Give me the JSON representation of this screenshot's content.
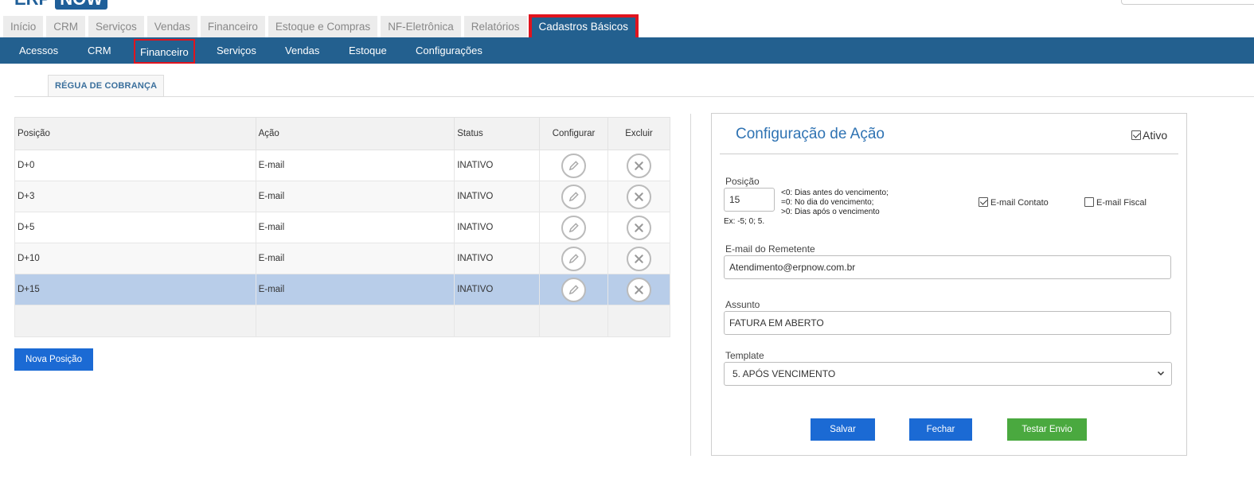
{
  "app": {
    "logo_prefix": "ERP",
    "logo_suffix": "NOW"
  },
  "main_tabs": [
    "Início",
    "CRM",
    "Serviços",
    "Vendas",
    "Financeiro",
    "Estoque e Compras",
    "NF-Eletrônica",
    "Relatórios",
    "Cadastros Básicos"
  ],
  "sub_nav": [
    "Acessos",
    "CRM",
    "Financeiro",
    "Serviços",
    "Vendas",
    "Estoque",
    "Configurações"
  ],
  "page_tab": "RÉGUA DE COBRANÇA",
  "table": {
    "headers": [
      "Posição",
      "Ação",
      "Status",
      "Configurar",
      "Excluir"
    ],
    "rows": [
      {
        "posicao": "D+0",
        "acao": "E-mail",
        "status": "INATIVO"
      },
      {
        "posicao": "D+3",
        "acao": "E-mail",
        "status": "INATIVO"
      },
      {
        "posicao": "D+5",
        "acao": "E-mail",
        "status": "INATIVO"
      },
      {
        "posicao": "D+10",
        "acao": "E-mail",
        "status": "INATIVO"
      },
      {
        "posicao": "D+15",
        "acao": "E-mail",
        "status": "INATIVO"
      }
    ]
  },
  "nova_posicao_label": "Nova Posição",
  "panel": {
    "title": "Configuração de Ação",
    "ativo_label": "Ativo",
    "posicao_label": "Posição",
    "posicao_value": "15",
    "hint_lines": [
      "<0: Dias antes do vencimento;",
      "=0: No dia do vencimento;",
      ">0: Dias após o vencimento"
    ],
    "example": "Ex: -5; 0; 5.",
    "email_contato_label": "E-mail Contato",
    "email_fiscal_label": "E-mail Fiscal",
    "remetente_label": "E-mail do Remetente",
    "remetente_value": "Atendimento@erpnow.com.br",
    "assunto_label": "Assunto",
    "assunto_value": "FATURA EM ABERTO",
    "template_label": "Template",
    "template_value": "5. APÓS VENCIMENTO",
    "salvar": "Salvar",
    "fechar": "Fechar",
    "testar": "Testar Envio"
  }
}
